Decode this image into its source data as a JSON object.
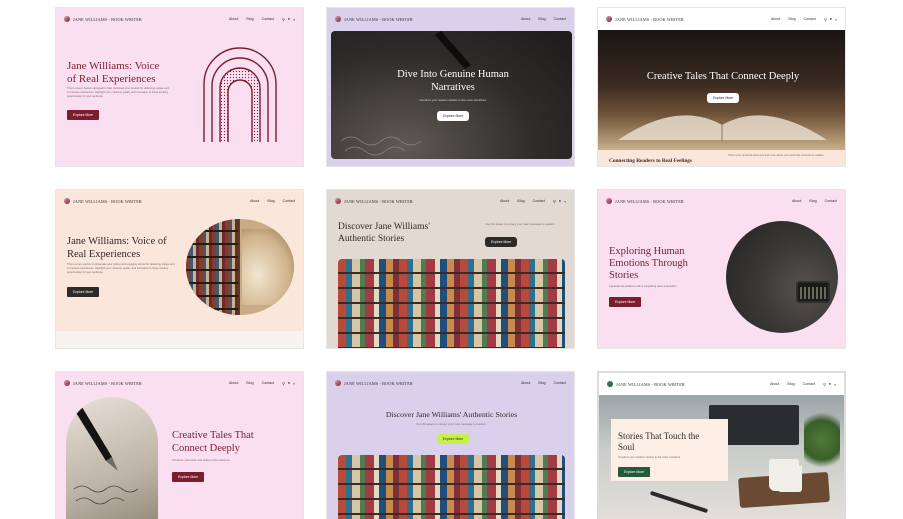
{
  "brand": "JANE WILLIAMS - BOOK WRITER",
  "nav_links": [
    "About",
    "Blog",
    "Contact"
  ],
  "cards": [
    {
      "title": "Jane Williams: Voice of Real Experiences",
      "subtitle": "This is a Hero Section designed to help showcase your product for delivering unique and immersive experiences. Highlight your creativity quality, and innovation to these exciting opportunities for your audience.",
      "button": "Explore More"
    },
    {
      "title": "Dive Into Genuine Human Narratives",
      "subtitle": "Introduce your readers mission to the voice narratives.",
      "button": "Explore More"
    },
    {
      "title": "Creative Tales That Connect Deeply",
      "button": "Explore More",
      "footer_heading": "Connecting Readers to Real Feelings",
      "footer_text": "This is your personal statement and more about your work that connects to readers."
    },
    {
      "title": "Jane Williams: Voice of Real Experiences",
      "subtitle": "This is a hero section to showcase your writing and engaging stories for delivering unique and immersive experiences. Highlight your creativity, quality, and innovation to these exciting opportunities for your audience.",
      "button": "Explore More"
    },
    {
      "title": "Discover Jane Williams' Authentic Stories",
      "subtitle": "Use this space to convey your main message to readers.",
      "button": "Explore More"
    },
    {
      "title": "Exploring Human Emotions Through Stories",
      "subtitle": "Captivate the audience with a compelling value proposition.",
      "button": "Explore More"
    },
    {
      "title": "Creative Tales That Connect Deeply",
      "subtitle": "Introduce your work and share to the audience.",
      "button": "Explore More"
    },
    {
      "title": "Discover Jane Williams' Authentic Stories",
      "subtitle": "Use this space to convey your main message to readers.",
      "button": "Explore More"
    },
    {
      "title": "Stories That Touch the Soul",
      "subtitle": "Introduce your reader's mission to the voice narratives.",
      "button": "Explore More"
    }
  ],
  "icons": [
    "search-icon",
    "user-icon",
    "cart-icon"
  ],
  "colors": {
    "pink_bg": "#f9dff0",
    "lavender_bg": "#d9d0ec",
    "peach_bg": "#fbe6dc",
    "maroon": "#7a1e2e",
    "lime": "#c8f04a",
    "green": "#235a3a"
  }
}
